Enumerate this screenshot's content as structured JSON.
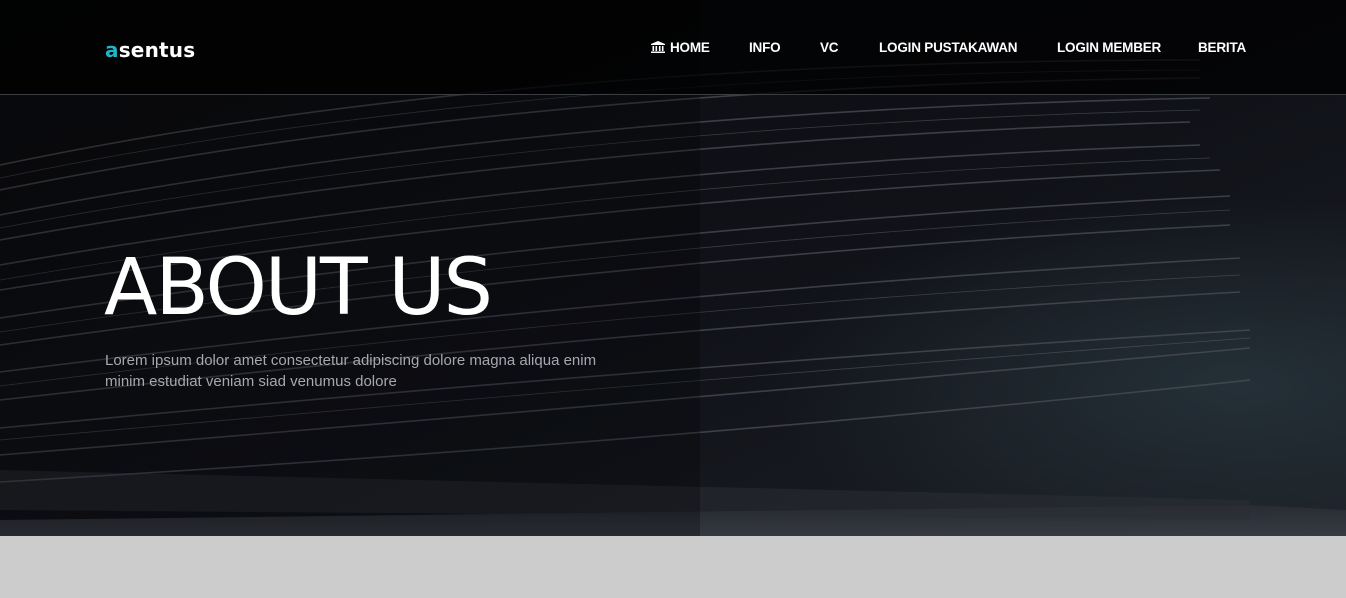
{
  "brand": {
    "accent_letter": "a",
    "rest": "sentus",
    "accent_color": "#1fb5c6"
  },
  "nav": {
    "home_icon": "bank-icon",
    "items": [
      {
        "label": "HOME"
      },
      {
        "label": "INFO"
      },
      {
        "label": "VC"
      },
      {
        "label": "LOGIN PUSTAKAWAN"
      },
      {
        "label": "LOGIN MEMBER"
      },
      {
        "label": "BERITA"
      }
    ]
  },
  "hero": {
    "title": "ABOUT US",
    "description": "Lorem ipsum dolor amet consectetur adipiscing dolore magna aliqua enim minim estudiat veniam siad venumus dolore"
  },
  "colors": {
    "background_dark": "#0b0c10",
    "lower_section": "#cccccc",
    "text_white": "#ffffff",
    "text_muted": "#a5a8ae"
  }
}
